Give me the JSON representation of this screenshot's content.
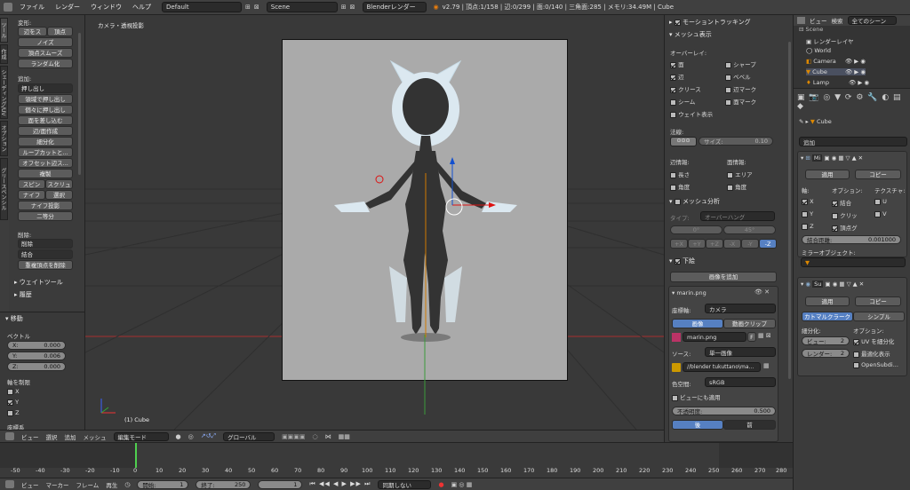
{
  "menu": [
    "ファイル",
    "レンダー",
    "ウィンドウ",
    "ヘルプ"
  ],
  "layout": "Default",
  "scene": "Scene",
  "engine": "Blenderレンダー",
  "stats": "v2.79 | 頂点:1/158 | 辺:0/299 | 面:0/140 | 三角面:285 | メモリ:34.49M | Cube",
  "tool_tabs": [
    "ツール",
    "作成",
    "シェーディング/UV",
    "オプション",
    "グリースペンシル"
  ],
  "tools": {
    "deform": "変形:",
    "b_edge_slide": "辺をス",
    "b_vertex": "頂点",
    "b_noise": "ノイズ",
    "b_smooth": "頂点スムーズ",
    "b_random": "ランダム化",
    "add": "追加:",
    "b_extrude": "押し出し",
    "b_extrude_region": "領域で押し出し",
    "b_extrude_indiv": "個々に押し出し",
    "b_inset": "面を差し込む",
    "b_edgeface": "辺/面作成",
    "b_subdivide": "細分化",
    "b_loopcut": "ループカットと...",
    "b_offset": "オフセット辺ス...",
    "b_dup": "複製",
    "b_spin": "スピン",
    "b_screw": "スクリュ",
    "b_knife": "ナイフ",
    "b_select": "選択",
    "b_knife_proj": "ナイフ投影",
    "b_bisect": "二等分",
    "delete": "削除:",
    "b_delete": "削除",
    "b_join": "結合",
    "b_remove_doubles": "重複頂点を削除",
    "weight": "ウェイトツール",
    "history": "履歴"
  },
  "op": {
    "title": "移動",
    "vector": "ベクトル",
    "x": "X:",
    "xv": "0.000",
    "y": "Y:",
    "yv": "0.006",
    "z": "Z:",
    "zv": "0.000",
    "constraint": "軸を制限",
    "cx": "X",
    "cy": "Y",
    "cz": "Z",
    "orient": "座標系"
  },
  "viewport": {
    "label": "カメラ・透視投影",
    "object": "(1) Cube"
  },
  "vheader": {
    "view": "ビュー",
    "select": "選択",
    "add": "追加",
    "mesh": "メッシュ",
    "mode": "編集モード",
    "orient": "グローバル"
  },
  "timeline": {
    "ticks": [
      "-50",
      "-40",
      "-30",
      "-20",
      "-10",
      "0",
      "10",
      "20",
      "30",
      "40",
      "50",
      "60",
      "70",
      "80",
      "90",
      "100",
      "110",
      "120",
      "130",
      "140",
      "150",
      "160",
      "170",
      "180",
      "190",
      "200",
      "210",
      "220",
      "230",
      "240",
      "250",
      "260",
      "270",
      "280"
    ],
    "view": "ビュー",
    "marker": "マーカー",
    "frame": "フレーム",
    "play": "再生",
    "start": "開始:",
    "start_v": "1",
    "end": "終了:",
    "end_v": "250",
    "cur": "1",
    "sync": "同期しない"
  },
  "npanel": {
    "motion": "モーショントラッキング",
    "mesh_disp": "メッシュ表示",
    "overlay": "オーバーレイ:",
    "face": "面",
    "sharp": "シャープ",
    "edge": "辺",
    "bevel": "ベベル",
    "crease": "クリース",
    "edge_mark": "辺マーク",
    "seam": "シーム",
    "face_mark": "面マーク",
    "weight": "ウェイト表示",
    "normal": "法線:",
    "size": "サイズ:",
    "size_v": "0.10",
    "edge_info": "辺情報:",
    "face_info": "面情報:",
    "length": "長さ",
    "area": "エリア",
    "angle": "角度",
    "angle2": "角度",
    "analysis": "メッシュ分析",
    "type": "タイプ:",
    "type_v": "オーバーハング",
    "deg0": "0°",
    "deg45": "45°",
    "axes": [
      "+X",
      "+Y",
      "+Z",
      "-X",
      "-Y",
      "-Z"
    ],
    "bg": "下絵",
    "add_image": "画像を追加",
    "img_name": "marin.png",
    "axis": "座標軸:",
    "axis_v": "カメラ",
    "tab_image": "画像",
    "tab_clip": "動画クリップ",
    "file": "marin.png",
    "f": "F",
    "source": "ソース:",
    "source_v": "単一画像",
    "path": "//blender tukuttano\\ma...",
    "colorspace": "色空間:",
    "colorspace_v": "sRGB",
    "view_as": "ビューにも適用",
    "opacity": "不透明度:",
    "opacity_v": "0.500",
    "back": "後",
    "front": "前"
  },
  "outliner": {
    "view": "ビュー",
    "search": "検索",
    "all": "全てのシーン",
    "scene": "Scene",
    "render": "レンダーレイヤ",
    "world": "World",
    "camera": "Camera",
    "cube": "Cube",
    "lamp": "Lamp"
  },
  "props": {
    "breadcrumb": "Cube",
    "add_mod": "追加",
    "m1_name": "Mi",
    "apply": "適用",
    "copy": "コピー",
    "axis": "軸:",
    "options": "オプション:",
    "texture": "テクスチャ:",
    "x": "X",
    "y": "Y",
    "z": "Z",
    "merge": "結合",
    "clip": "クリッ",
    "vertgroup": "頂点グ",
    "u": "U",
    "v": "V",
    "merge_dist": "結合距離:",
    "merge_v": "0.001000",
    "mirror_obj": "ミラーオブジェクト:",
    "m2_name": "Su",
    "apply2": "適用",
    "copy2": "コピー",
    "catmull": "カトマルクラーク",
    "simple": "シンプル",
    "subdiv": "細分化:",
    "opt2": "オプション:",
    "view_lvl": "ビュー:",
    "view_v": "2",
    "render_lvl": "レンダー:",
    "render_v": "2",
    "uv": "UV を細分化",
    "optimal": "最適化表示",
    "opensubdiv": "OpenSubdi..."
  }
}
